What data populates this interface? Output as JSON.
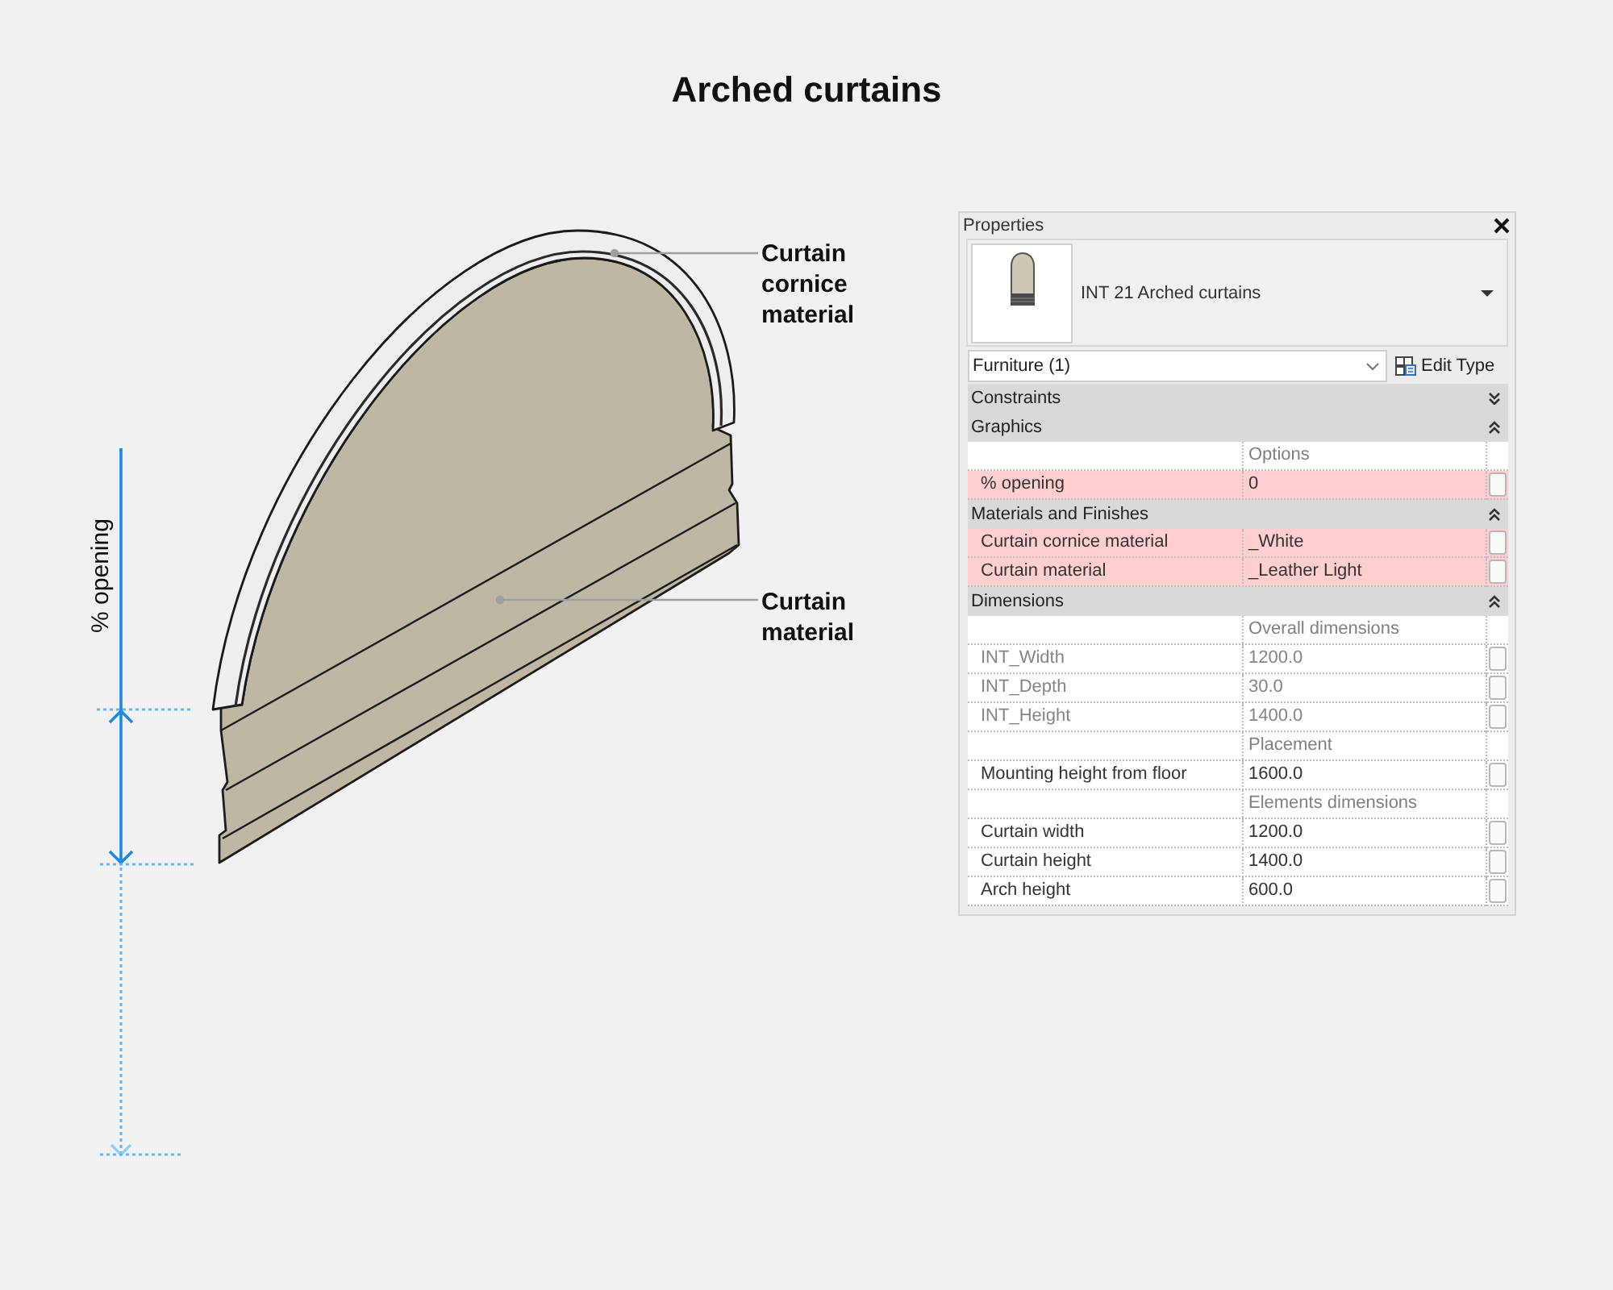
{
  "title": "Arched curtains",
  "diagram": {
    "callouts": [
      {
        "label": "Curtain cornice material"
      },
      {
        "label": "Curtain material"
      }
    ],
    "dimension_label": "% opening"
  },
  "properties": {
    "title": "Properties",
    "type_name": "INT 21 Arched curtains",
    "category_filter": "Furniture (1)",
    "edit_type_label": "Edit Type",
    "groups": [
      {
        "name": "Constraints",
        "expanded": false
      },
      {
        "name": "Graphics",
        "expanded": true,
        "rows": [
          {
            "kind": "subheading",
            "label": "Options"
          },
          {
            "kind": "param",
            "name": "% opening",
            "value": "0",
            "highlighted": true,
            "disabled": false
          }
        ]
      },
      {
        "name": "Materials and Finishes",
        "expanded": true,
        "rows": [
          {
            "kind": "param",
            "name": "Curtain cornice material",
            "value": "_White",
            "highlighted": true,
            "disabled": false
          },
          {
            "kind": "param",
            "name": "Curtain material",
            "value": "_Leather Light",
            "highlighted": true,
            "disabled": false
          }
        ]
      },
      {
        "name": "Dimensions",
        "expanded": true,
        "rows": [
          {
            "kind": "subheading",
            "label": "Overall dimensions"
          },
          {
            "kind": "param",
            "name": "INT_Width",
            "value": "1200.0",
            "highlighted": false,
            "disabled": true
          },
          {
            "kind": "param",
            "name": "INT_Depth",
            "value": "30.0",
            "highlighted": false,
            "disabled": true
          },
          {
            "kind": "param",
            "name": "INT_Height",
            "value": "1400.0",
            "highlighted": false,
            "disabled": true
          },
          {
            "kind": "subheading",
            "label": "Placement"
          },
          {
            "kind": "param",
            "name": "Mounting height from floor",
            "value": "1600.0",
            "highlighted": false,
            "disabled": false
          },
          {
            "kind": "subheading",
            "label": "Elements dimensions"
          },
          {
            "kind": "param",
            "name": "Curtain width",
            "value": "1200.0",
            "highlighted": false,
            "disabled": false
          },
          {
            "kind": "param",
            "name": "Curtain height",
            "value": "1400.0",
            "highlighted": false,
            "disabled": false
          },
          {
            "kind": "param",
            "name": "Arch height",
            "value": "600.0",
            "highlighted": false,
            "disabled": false
          }
        ]
      }
    ]
  }
}
